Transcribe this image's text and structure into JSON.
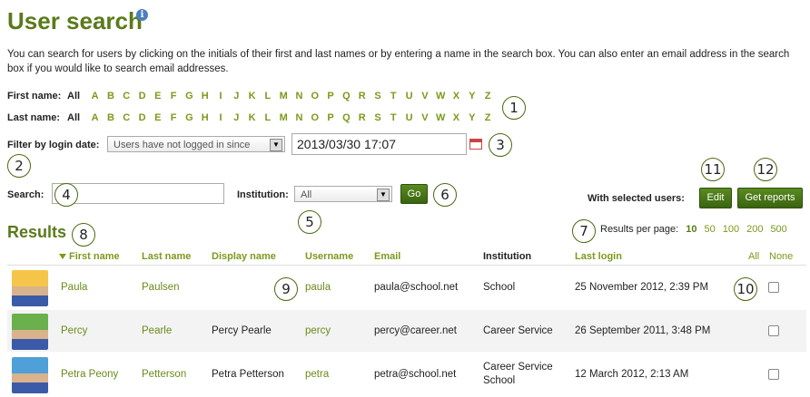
{
  "page": {
    "title": "User search",
    "info_icon": "info-icon",
    "intro": "You can search for users by clicking on the initials of their first and last names or by entering a name in the search box. You can also enter an email address in the search box if you would like to search email addresses."
  },
  "alpha": {
    "first_label": "First name:",
    "last_label": "Last name:",
    "all": "All",
    "letters": [
      "A",
      "B",
      "C",
      "D",
      "E",
      "F",
      "G",
      "H",
      "I",
      "J",
      "K",
      "L",
      "M",
      "N",
      "O",
      "P",
      "Q",
      "R",
      "S",
      "T",
      "U",
      "V",
      "W",
      "X",
      "Y",
      "Z"
    ]
  },
  "filter": {
    "label": "Filter by login date:",
    "select_value": "Users have not logged in since",
    "date_value": "2013/03/30 17:07",
    "calendar_icon": "calendar-icon"
  },
  "search": {
    "label": "Search:",
    "value": "",
    "institution_label": "Institution:",
    "institution_value": "All",
    "go_label": "Go"
  },
  "selected": {
    "label": "With selected users:",
    "edit_label": "Edit",
    "reports_label": "Get reports"
  },
  "results": {
    "title": "Results",
    "per_page_label": "Results per page:",
    "per_page_options": [
      "10",
      "50",
      "100",
      "200",
      "500"
    ],
    "current_per_page": "10",
    "sort_icon": "sort-down-icon",
    "columns": {
      "first": "First name",
      "last": "Last name",
      "display": "Display name",
      "username": "Username",
      "email": "Email",
      "institution": "Institution",
      "last_login": "Last login",
      "all": "All",
      "none": "None"
    },
    "rows": [
      {
        "first": "Paula",
        "last": "Paulsen",
        "display": "",
        "username": "paula",
        "email": "paula@school.net",
        "institution": "School",
        "last_login": "25 November 2012, 2:39 PM",
        "avatar_color": "#f5c54a",
        "checked": false
      },
      {
        "first": "Percy",
        "last": "Pearle",
        "display": "Percy Pearle",
        "username": "percy",
        "email": "percy@career.net",
        "institution": "Career Service",
        "last_login": "26 September 2011, 3:48 PM",
        "avatar_color": "#6ab04c",
        "checked": false
      },
      {
        "first": "Petra Peony",
        "last": "Petterson",
        "display": "Petra Petterson",
        "username": "petra",
        "email": "petra@school.net",
        "institution": "Career Service School",
        "last_login": "12 March 2012, 2:13 AM",
        "avatar_color": "#4fa0d8",
        "checked": false
      }
    ]
  },
  "callouts": [
    "1",
    "2",
    "3",
    "4",
    "5",
    "6",
    "7",
    "8",
    "9",
    "10",
    "11",
    "12"
  ],
  "colors": {
    "accent": "#5a7a1a",
    "link": "#7a9a1a",
    "button": "#4a7a18"
  }
}
